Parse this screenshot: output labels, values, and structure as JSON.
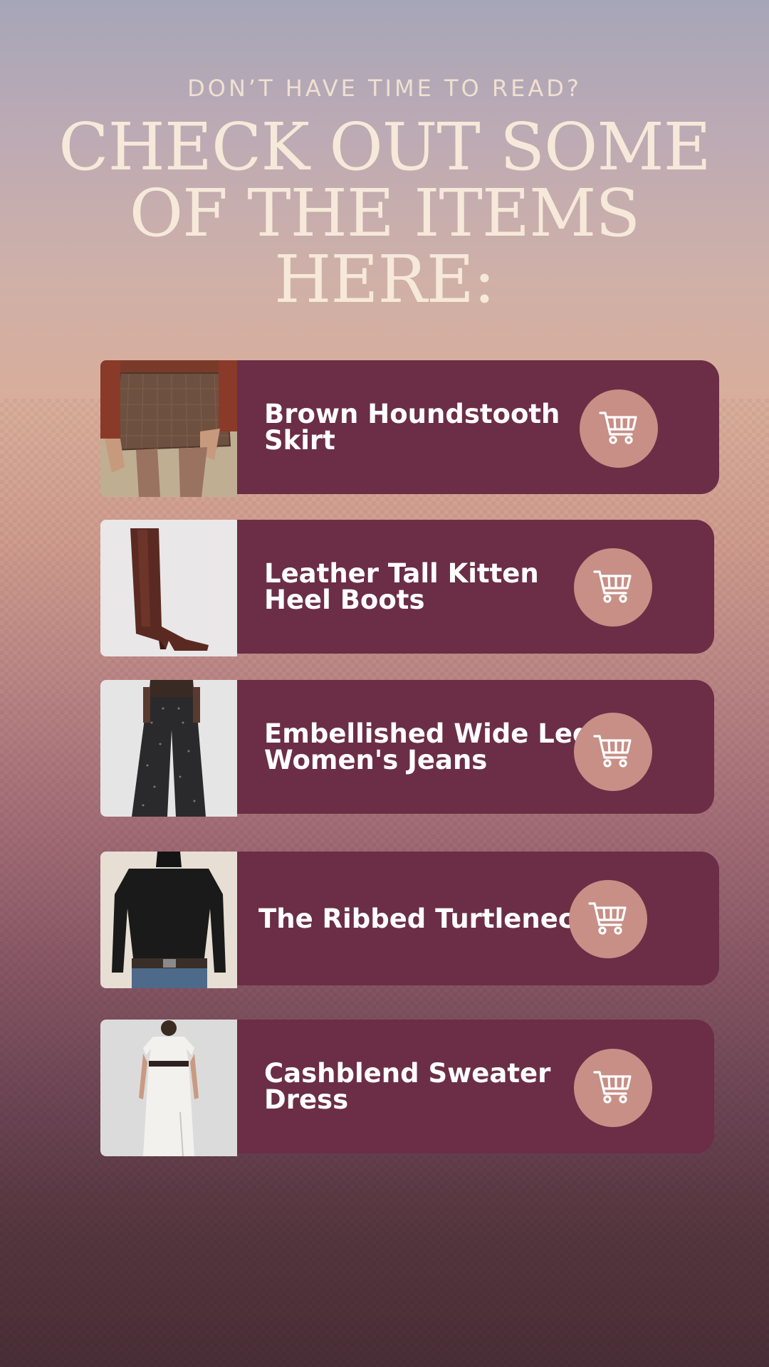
{
  "header": {
    "subtitle": "DON’T HAVE TIME TO READ?",
    "title": "CHECK OUT SOME OF THE ITEMS HERE:"
  },
  "colors": {
    "panel": "#6b2e46",
    "cart_button": "#c78f86",
    "title_text": "#f6e9da"
  },
  "items": [
    {
      "label_line1": "Brown Houndstooth",
      "label_line2": "Skirt",
      "icon": "shopping-cart-icon"
    },
    {
      "label_line1": "Leather Tall Kitten",
      "label_line2": "Heel Boots",
      "icon": "shopping-cart-icon"
    },
    {
      "label_line1": "Embellished Wide Leg",
      "label_line2": "Women's Jeans",
      "icon": "shopping-cart-icon"
    },
    {
      "label_line1": "The Ribbed Turtleneck",
      "label_line2": "",
      "icon": "shopping-cart-icon"
    },
    {
      "label_line1": "Cashblend Sweater",
      "label_line2": "Dress",
      "icon": "shopping-cart-icon"
    }
  ]
}
